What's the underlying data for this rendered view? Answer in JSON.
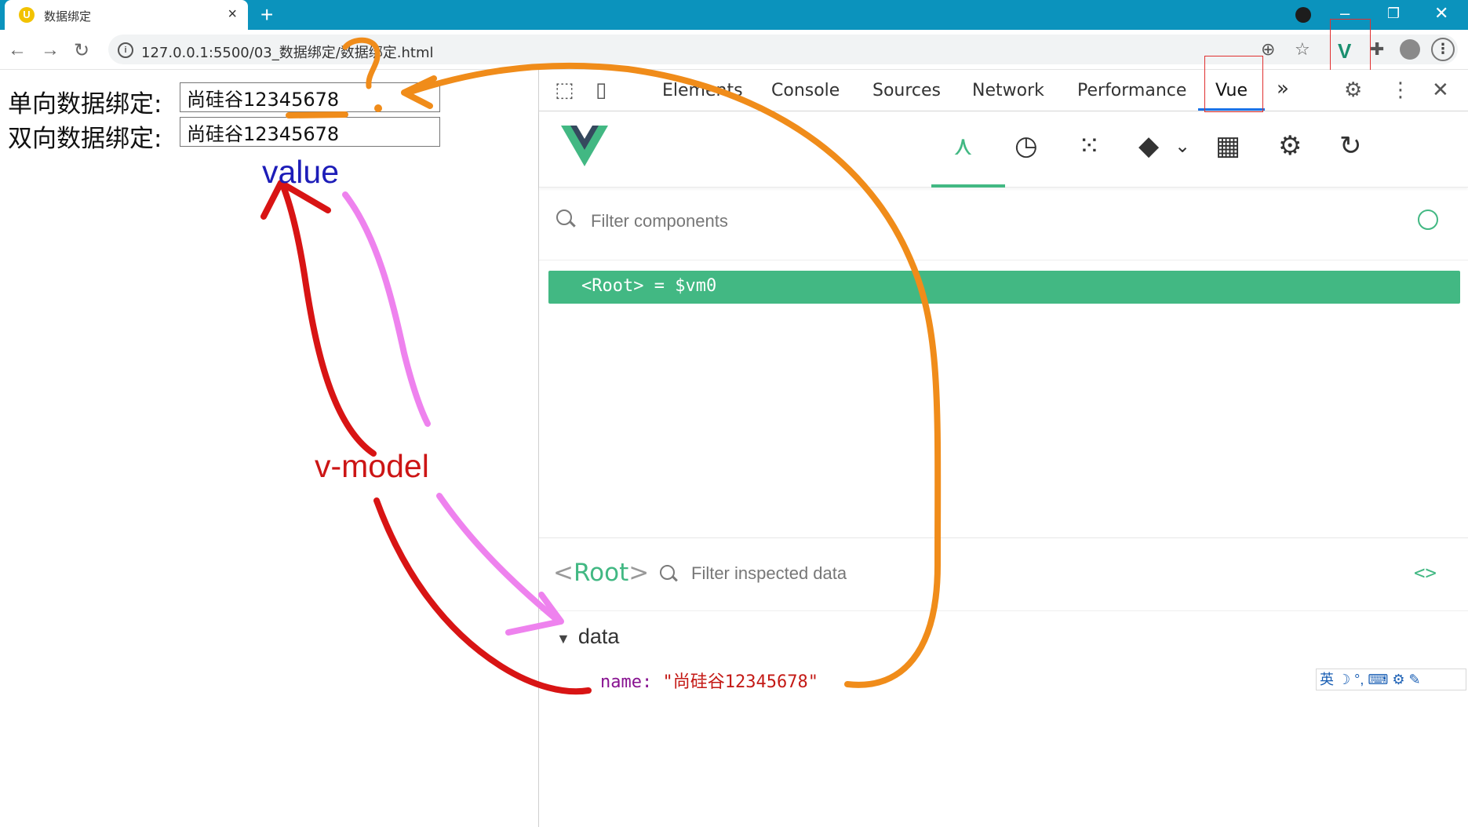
{
  "browser": {
    "tab_title": "数据绑定",
    "tab_close": "×",
    "new_tab": "+",
    "url": "127.0.0.1:5500/03_数据绑定/数据绑定.html",
    "window_minimize": "–",
    "window_restore": "❐",
    "window_close": "✕"
  },
  "page": {
    "one_way_label": "单向数据绑定:",
    "one_way_value": "尚硅谷12345678",
    "two_way_label": "双向数据绑定:",
    "two_way_value": "尚硅谷12345678"
  },
  "devtools": {
    "tabs": [
      "Elements",
      "Console",
      "Sources",
      "Network",
      "Performance",
      "Vue"
    ],
    "active_tab": "Vue",
    "more_tabs": "»",
    "filter_components_placeholder": "Filter components",
    "root_component": "<Root> = $vm0",
    "inspector_title_open": "<",
    "inspector_title_name": "Root",
    "inspector_title_close": ">",
    "filter_inspected_placeholder": "Filter inspected data",
    "code_toggle": "<>",
    "data_section": "data",
    "data_key": "name:",
    "data_value": "\"尚硅谷12345678\"",
    "ime": "英 ☽ °, ⌨ ⚙ ✎"
  },
  "annotations": {
    "value_label": "value",
    "vmodel_label": "v-model",
    "question_mark": "?"
  },
  "colors": {
    "titlebar": "#0b93bd",
    "vue_green": "#42b883",
    "annotation_orange": "#f08c1a",
    "annotation_red": "#d81414",
    "annotation_pink": "#ee82ee",
    "annotation_blue": "#1d1db8",
    "highlight_box": "#e03030"
  }
}
